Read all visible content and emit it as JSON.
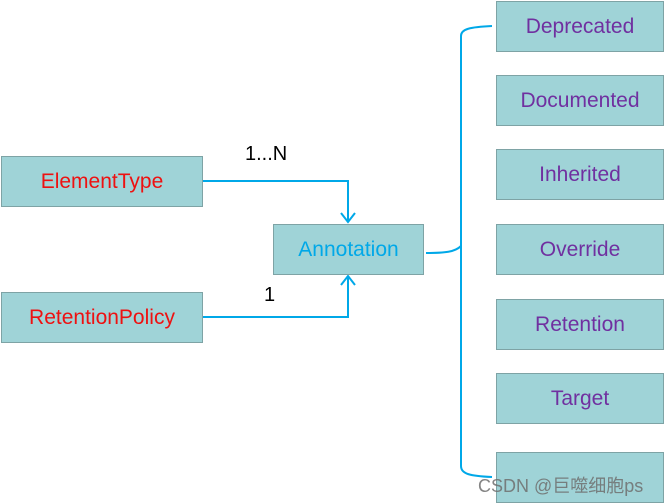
{
  "sources": [
    {
      "label": "ElementType",
      "multiplicity": "1...N"
    },
    {
      "label": "RetentionPolicy",
      "multiplicity": "1"
    }
  ],
  "center": {
    "label": "Annotation"
  },
  "annotations": [
    {
      "label": "Deprecated"
    },
    {
      "label": "Documented"
    },
    {
      "label": "Inherited"
    },
    {
      "label": "Override"
    },
    {
      "label": "Retention"
    },
    {
      "label": "Target"
    },
    {
      "label": ""
    }
  ],
  "watermark": "CSDN @巨噬细胞ps",
  "colors": {
    "box_fill": "#9fd3d7",
    "connector": "#00a8e8",
    "source_text": "#ee1111",
    "center_text": "#00a8e8",
    "annotation_text": "#7030a0"
  }
}
